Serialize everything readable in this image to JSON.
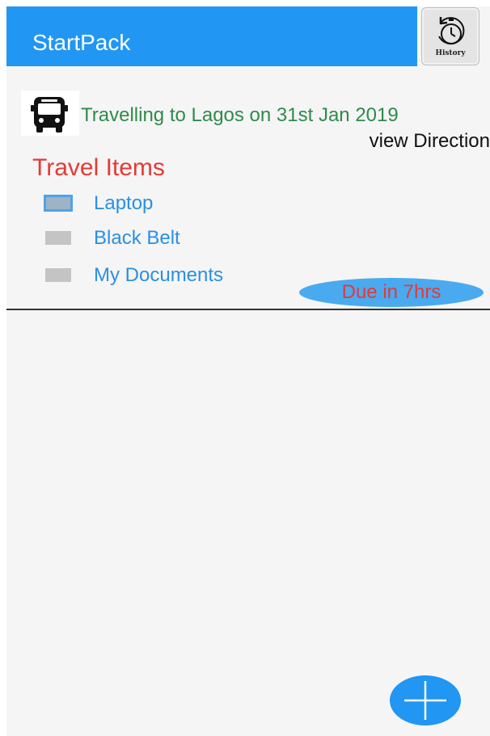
{
  "app": {
    "title": "StartPack"
  },
  "history_button": {
    "label": "History",
    "icon": "history-stopwatch-icon"
  },
  "trip": {
    "icon": "bus-icon",
    "text": "Travelling to Lagos on 31st Jan 2019",
    "view_direction_label": "view Direction"
  },
  "travel_items": {
    "title": "Travel Items",
    "items": [
      {
        "label": "Laptop",
        "checked": true
      },
      {
        "label": "Black Belt",
        "checked": false
      },
      {
        "label": "My Documents",
        "checked": false
      }
    ]
  },
  "due": {
    "label": "Due in 7hrs"
  },
  "fab": {
    "icon": "plus-icon"
  },
  "colors": {
    "app_bar": "#2196f3",
    "trip_text": "#2e8b4a",
    "section_title": "#e53935",
    "item_label": "#2a8fe6",
    "due_badge": "#4aaaf0",
    "due_text": "#e53935"
  }
}
